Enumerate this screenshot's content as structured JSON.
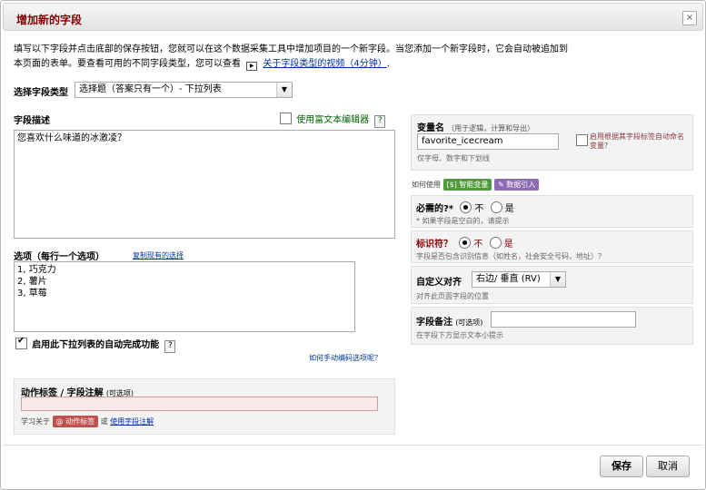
{
  "dialog": {
    "title": "增加新的字段",
    "close_label": "×"
  },
  "intro": {
    "line1": "填写以下字段并点击底部的保存按钮，您就可以在这个数据采集工具中增加项目的一个新字段。当您添加一个新字段时，它会自动被追加到",
    "line2_prefix": "本页面的表单。要查看可用的不同字段类型，您可以查看",
    "video_link": "关于字段类型的视频（4分钟）",
    "line2_suffix": "."
  },
  "field_type": {
    "label": "选择字段类型",
    "value": "选择题（答案只有一个）- 下拉列表"
  },
  "field_label": {
    "label": "字段描述",
    "rich_text_label": "使用富文本编辑器",
    "help": "?",
    "value": "您喜欢什么味道的冰激凌？"
  },
  "choices": {
    "label": "选项（每行一个选项）",
    "copy_link": "复制现有的选择",
    "lines": [
      "1, 巧克力",
      "2, 薯片",
      "3, 草莓"
    ]
  },
  "autocomplete": {
    "label": "启用此下拉列表的自动完成功能",
    "help": "?",
    "checked": true,
    "manual_link": "如何手动编码选项呢？"
  },
  "action_tags": {
    "label": "动作标签 / 字段注解",
    "optional": "(可选项)",
    "learn_prefix": "学习关于",
    "tags_badge": "@ 动作标签",
    "or": "或",
    "annotation_link": "使用字段注解",
    "value": ""
  },
  "variable": {
    "label": "变量名",
    "hint": "（用于逻辑，计算和导出）",
    "value": "favorite_icecream",
    "auto_label": "启用根据其字段标签自动命名变量？",
    "note": "仅字母、数字和下划线"
  },
  "howto": {
    "prefix": "如何使用",
    "smart_vars": "[$] 智能变量",
    "piping": "✎ 数据引入"
  },
  "required": {
    "label": "必需的?*",
    "no": "不",
    "yes": "是",
    "note": "* 如果字段是空白的，请提示"
  },
  "identifier": {
    "label": "标识符？",
    "no": "不",
    "yes": "是",
    "note": "字段是否包含识别信息（如姓名，社会安全号码，地址）？"
  },
  "alignment": {
    "label": "自定义对齐",
    "value": "右边/ 垂直 (RV)",
    "note": "对齐此页面字段的位置"
  },
  "field_note": {
    "label": "字段备注",
    "optional": "(可选项)",
    "note": "在字段下方显示文本小提示",
    "value": ""
  },
  "footer": {
    "save": "保存",
    "cancel": "取消"
  },
  "colors": {
    "title": "#800000",
    "link": "#003399",
    "badge_red": "#c0504d",
    "badge_green": "#4f9a3a",
    "badge_purple": "#8e6bb5"
  }
}
